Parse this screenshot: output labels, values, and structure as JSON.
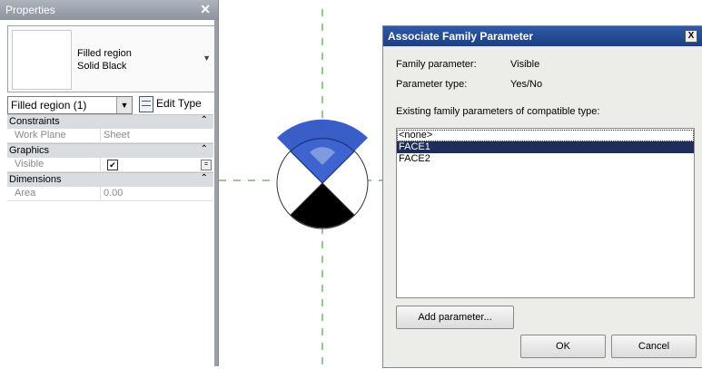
{
  "properties": {
    "title": "Properties",
    "close_glyph": "✕",
    "type_line1": "Filled region",
    "type_line2": "Solid Black",
    "type_dropdown_glyph": "▼",
    "filter_label": "Filled region (1)",
    "filter_arrow_glyph": "▼",
    "edit_type_label": "Edit Type",
    "sections": [
      {
        "label": "Constraints",
        "chevron": "⌃",
        "rows": [
          {
            "name": "Work Plane",
            "value": "Sheet"
          }
        ]
      },
      {
        "label": "Graphics",
        "chevron": "⌃",
        "rows": [
          {
            "name": "Visible",
            "checked": true,
            "check_glyph": "✔",
            "button_glyph": "="
          }
        ]
      },
      {
        "label": "Dimensions",
        "chevron": "⌃",
        "rows": [
          {
            "name": "Area",
            "value": "0.00"
          }
        ]
      }
    ]
  },
  "canvas": {
    "symbol_colors": {
      "highlight": "#2f55c4",
      "fill": "#000000",
      "outline": "#333333",
      "guide": "#2f8f2f"
    }
  },
  "dialog": {
    "title": "Associate Family Parameter",
    "close_glyph": "X",
    "family_parameter_label": "Family parameter:",
    "family_parameter_value": "Visible",
    "parameter_type_label": "Parameter type:",
    "parameter_type_value": "Yes/No",
    "existing_label": "Existing family parameters of compatible type:",
    "options": [
      "<none>",
      "FACE1",
      "FACE2"
    ],
    "selected_index": 1,
    "add_parameter_label": "Add parameter...",
    "ok_label": "OK",
    "cancel_label": "Cancel"
  }
}
